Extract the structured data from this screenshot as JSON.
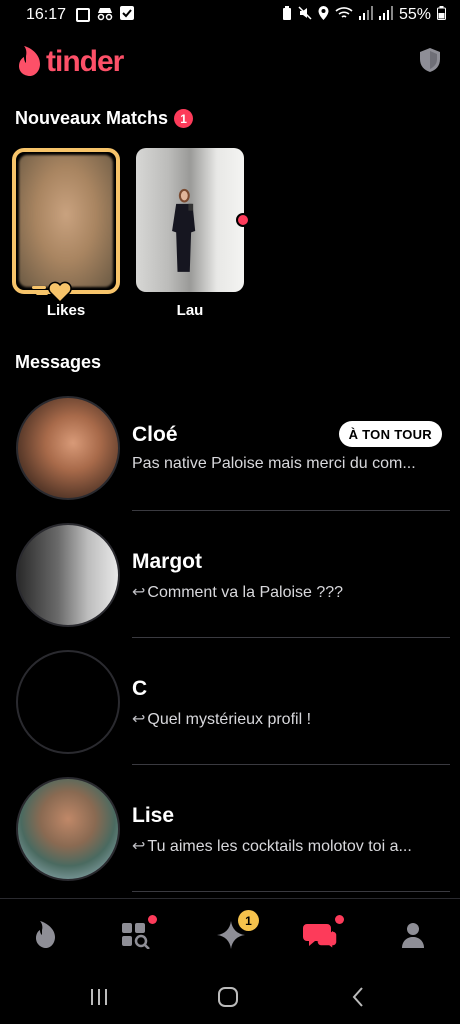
{
  "status_bar": {
    "time": "16:17",
    "battery": "55%"
  },
  "header": {
    "logo_text": "tinder",
    "brand_color": "#fd5068"
  },
  "new_matches": {
    "title": "Nouveaux Matchs",
    "count": "1",
    "cards": [
      {
        "label": "Likes"
      },
      {
        "label": "Lau"
      }
    ]
  },
  "messages": {
    "title": "Messages",
    "items": [
      {
        "name": "Cloé",
        "text": "Pas native Paloise mais merci du com...",
        "badge": "À TON TOUR",
        "reply_icon": false
      },
      {
        "name": "Margot",
        "text": "Comment va la Paloise ???",
        "reply_icon": true
      },
      {
        "name": "C",
        "text": "Quel mystérieux profil !",
        "reply_icon": true
      },
      {
        "name": "Lise",
        "text": "Tu aimes les cocktails molotov toi a...",
        "reply_icon": true
      }
    ]
  },
  "bottom_nav": {
    "items": [
      {
        "icon": "flame-icon"
      },
      {
        "icon": "explore-icon"
      },
      {
        "icon": "sparkle-icon",
        "badge": "1"
      },
      {
        "icon": "chat-icon"
      },
      {
        "icon": "profile-icon"
      }
    ],
    "badge_color": "#f5c24c",
    "accent": "#fd3b5a"
  }
}
